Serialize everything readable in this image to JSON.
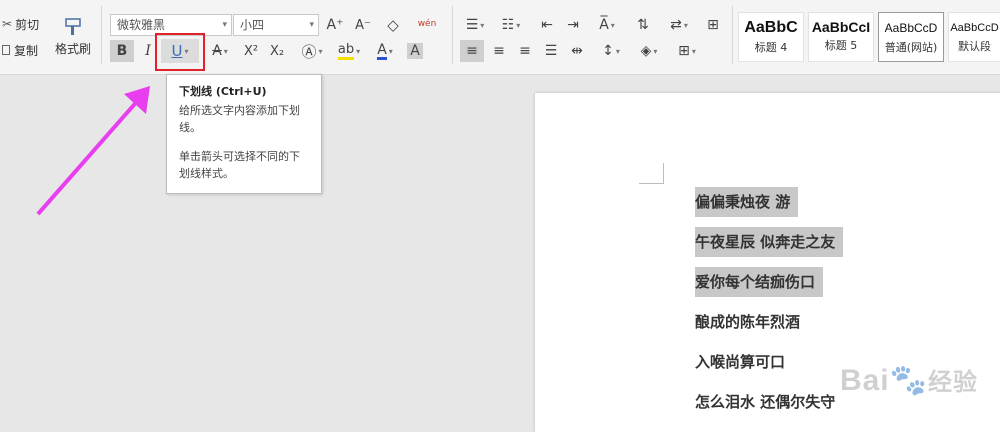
{
  "toolbar": {
    "cut_label": "剪切",
    "copy_label": "复制",
    "format_painter_label": "格式刷",
    "font_name": "微软雅黑",
    "font_size": "小四",
    "bold_label": "B",
    "italic_label": "I",
    "underline_label": "U",
    "strike_label": "A",
    "superscript_label": "X²",
    "subscript_label": "X₂",
    "highlight_label": "ab",
    "fontcolor_label": "A",
    "charshade_label": "A",
    "grow_label": "A⁺",
    "shrink_label": "A⁻",
    "phonetic_label": "wén"
  },
  "styles": [
    {
      "preview": "AaBbC",
      "name": "标题 4"
    },
    {
      "preview": "AaBbCcI",
      "name": "标题 5"
    },
    {
      "preview": "AaBbCcD",
      "name": "普通(网站)"
    },
    {
      "preview": "AaBbCcD",
      "name": "默认段"
    }
  ],
  "tooltip": {
    "title": "下划线 (Ctrl+U)",
    "desc": "给所选文字内容添加下划线。",
    "hint": "单击箭头可选择不同的下划线样式。"
  },
  "document": {
    "lines": [
      {
        "text": "偏偏秉烛夜 游",
        "selected": true
      },
      {
        "text": "午夜星辰 似奔走之友",
        "selected": true
      },
      {
        "text": "爱你每个结痂伤口",
        "selected": true
      },
      {
        "text": "酿成的陈年烈酒",
        "selected": false
      },
      {
        "text": "入喉尚算可口",
        "selected": false
      },
      {
        "text": "怎么泪水 还偶尔失守",
        "selected": false
      }
    ]
  },
  "watermark": {
    "text": "Bai",
    "text2": "经验"
  },
  "colors": {
    "accent_red": "#e2212a",
    "arrow_magenta": "#e83ef0",
    "selection_gray": "#c8c8c8"
  }
}
